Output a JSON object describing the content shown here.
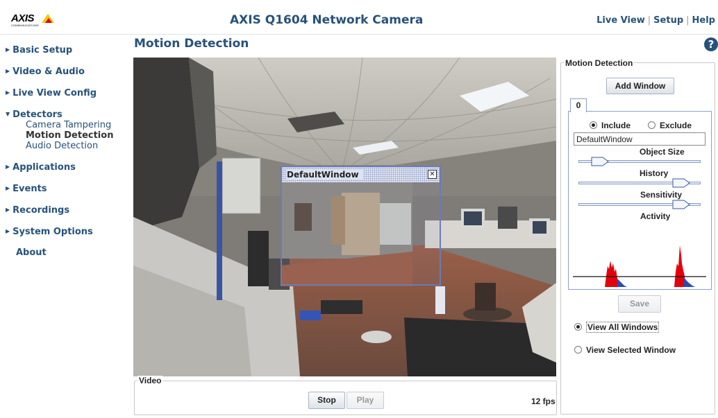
{
  "header": {
    "logo_text": "AXIS",
    "logo_subtext": "COMMUNICATIONS",
    "app_title": "AXIS Q1604 Network Camera",
    "links": [
      "Live View",
      "Setup",
      "Help"
    ]
  },
  "sidebar": {
    "items": [
      {
        "label": "Basic Setup",
        "expanded": false
      },
      {
        "label": "Video & Audio",
        "expanded": false
      },
      {
        "label": "Live View Config",
        "expanded": false
      },
      {
        "label": "Detectors",
        "expanded": true
      },
      {
        "label": "Applications",
        "expanded": false
      },
      {
        "label": "Events",
        "expanded": false
      },
      {
        "label": "Recordings",
        "expanded": false
      },
      {
        "label": "System Options",
        "expanded": false
      },
      {
        "label": "About",
        "expanded": false
      }
    ],
    "detectors_sub": [
      {
        "label": "Camera Tampering",
        "active": false
      },
      {
        "label": "Motion Detection",
        "active": true
      },
      {
        "label": "Audio Detection",
        "active": false
      }
    ]
  },
  "main": {
    "page_title": "Motion Detection",
    "help_icon": "question-icon",
    "video": {
      "window_title": "DefaultWindow",
      "legend": "Video",
      "stop_label": "Stop",
      "play_label": "Play",
      "fps": "12 fps"
    }
  },
  "motion_panel": {
    "legend": "Motion Detection",
    "add_window_label": "Add Window",
    "tab_label": "0",
    "include_label": "Include",
    "exclude_label": "Exclude",
    "include_selected": true,
    "window_name": "DefaultWindow",
    "object_size_label": "Object Size",
    "object_size_level": 0.12,
    "history_label": "History",
    "history_level": 0.9,
    "sensitivity_label": "Sensitivity",
    "sensitivity_level": 0.9,
    "activity_label": "Activity",
    "save_label": "Save",
    "view_all_label": "View All Windows",
    "view_selected_label": "View Selected Window",
    "view_all_selected": true
  },
  "colors": {
    "accent": "#27527b",
    "activity_fill": "#e3000b",
    "activity_level": "#2a4bb8"
  }
}
